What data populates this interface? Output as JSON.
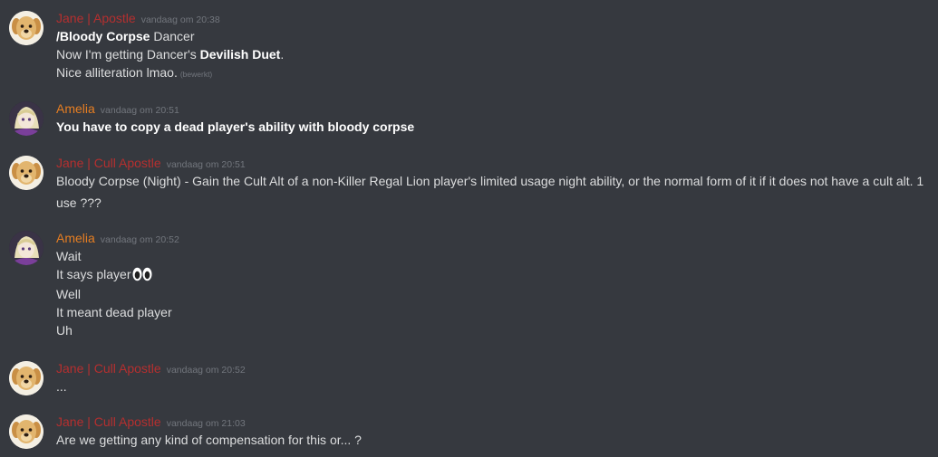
{
  "messages": [
    {
      "author": "Jane | Apostle",
      "timestamp": "vandaag om 20:38",
      "line1": {
        "command": "/Bloody Corpse",
        "rest": " Dancer"
      },
      "line2": {
        "before": "Now I'm getting Dancer's ",
        "bold": "Devilish Duet",
        "after": "."
      },
      "line3": {
        "text": "Nice alliteration lmao.",
        "edited": "(bewerkt)"
      }
    },
    {
      "author": "Amelia",
      "timestamp": "vandaag om 20:51",
      "line1": "You have to copy a dead player's ability with bloody corpse"
    },
    {
      "author": "Jane | Cull Apostle",
      "timestamp": "vandaag om 20:51",
      "line1": "Bloody Corpse (Night) - Gain the Cult Alt of a non-Killer Regal Lion player's limited usage night ability, or the normal form of it if it does not have a cult alt. 1 use ???"
    },
    {
      "author": "Amelia",
      "timestamp": "vandaag om 20:52",
      "line1": "Wait",
      "line2": "It says player",
      "line3": "Well",
      "line4": "It meant dead player",
      "line5": "Uh"
    },
    {
      "author": "Jane | Cull Apostle",
      "timestamp": "vandaag om 20:52",
      "line1": "..."
    },
    {
      "author": "Jane | Cull Apostle",
      "timestamp": "vandaag om 21:03",
      "line1": "Are we getting any kind of compensation for this or... ?"
    }
  ],
  "icons": {
    "jane_avatar": "golden-retriever-avatar",
    "amelia_avatar": "anime-character-avatar",
    "eyes_emoji": "eyes-emoji"
  },
  "colors": {
    "background": "#36393f",
    "jane_name": "#b52f2f",
    "amelia_name": "#e67e22",
    "text": "#dcddde",
    "timestamp": "#72767d"
  }
}
